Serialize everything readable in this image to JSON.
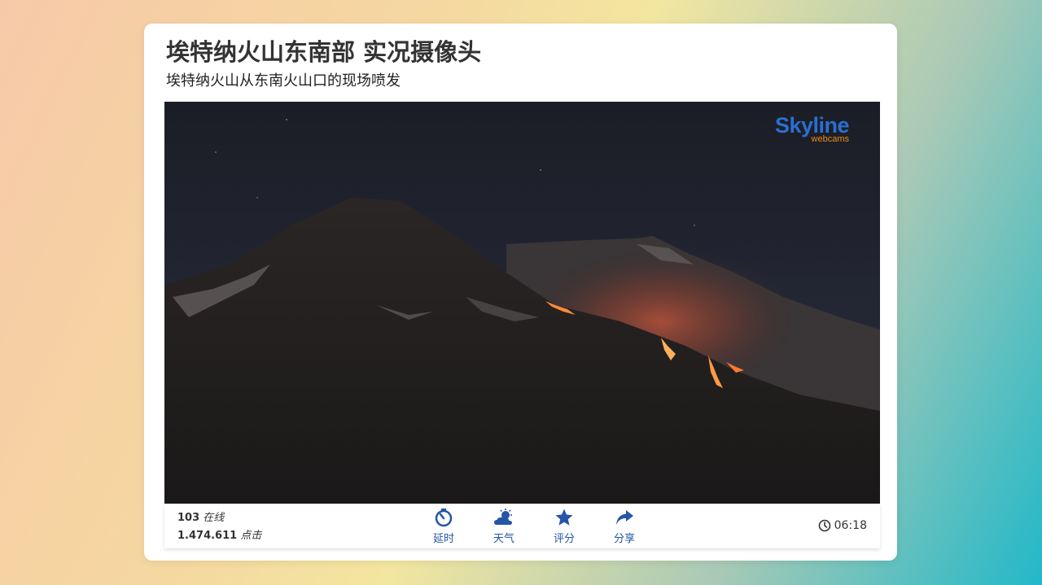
{
  "header": {
    "title": "埃特纳火山东南部 实况摄像头",
    "subtitle": "埃特纳火山从东南火山口的现场喷发"
  },
  "video": {
    "logo_main": "Skyline",
    "logo_sub": "webcams"
  },
  "stats": {
    "online_count": "103",
    "online_label": "在线",
    "views_count": "1.474.611",
    "views_label": "点击"
  },
  "actions": [
    {
      "label": "延时",
      "icon": "timelapse-icon"
    },
    {
      "label": "天气",
      "icon": "weather-icon"
    },
    {
      "label": "评分",
      "icon": "star-icon"
    },
    {
      "label": "分享",
      "icon": "share-icon"
    }
  ],
  "clock": {
    "time": "06:18",
    "icon": "clock-icon"
  },
  "colors": {
    "accent": "#2456a6",
    "logo_blue": "#2a6fd0",
    "logo_orange": "#f08a1c"
  }
}
